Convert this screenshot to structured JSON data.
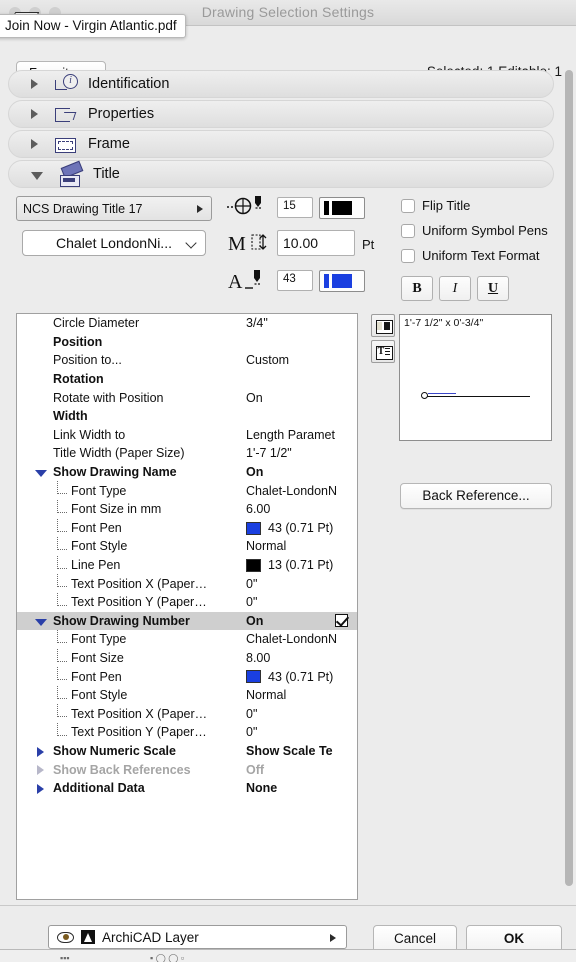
{
  "window": {
    "title": "Drawing Selection Settings",
    "tooltip": "Join Now - Virgin Atlantic.pdf"
  },
  "toolbar": {
    "favorites_label": "Favorites...",
    "selection_info": "Selected: 1 Editable: 1"
  },
  "sections": [
    {
      "label": "Identification",
      "icon": "identification-icon",
      "expanded": false
    },
    {
      "label": "Properties",
      "icon": "properties-icon",
      "expanded": false
    },
    {
      "label": "Frame",
      "icon": "frame-icon",
      "expanded": false
    },
    {
      "label": "Title",
      "icon": "title-icon",
      "expanded": true
    }
  ],
  "controls": {
    "title_style_popup": "NCS Drawing Title 17",
    "font_family": "Chalet LondonNi...",
    "symbol_pen_value": "15",
    "font_size_value": "10.00",
    "font_size_unit": "Pt",
    "text_pen_value": "43",
    "symbol_pen_color": "#000000",
    "text_pen_color": "#1a3fe0",
    "checkboxes": [
      {
        "label": "Flip Title",
        "checked": false
      },
      {
        "label": "Uniform Symbol Pens",
        "checked": false
      },
      {
        "label": "Uniform Text Format",
        "checked": false
      }
    ],
    "style_buttons": [
      {
        "label": "B",
        "name": "bold-button"
      },
      {
        "label": "I",
        "name": "italic-button"
      },
      {
        "label": "U",
        "name": "underline-button"
      }
    ]
  },
  "parameters": [
    {
      "name": "Circle Diameter",
      "value": "3/4\"",
      "level": 0,
      "bold": false,
      "tri": "none"
    },
    {
      "name": "Position",
      "value": "",
      "level": 0,
      "bold": true,
      "tri": "none"
    },
    {
      "name": "Position to...",
      "value": "Custom",
      "level": 0,
      "bold": false,
      "tri": "none"
    },
    {
      "name": "Rotation",
      "value": "",
      "level": 0,
      "bold": true,
      "tri": "none"
    },
    {
      "name": "Rotate with Position",
      "value": "On",
      "level": 0,
      "bold": false,
      "tri": "none"
    },
    {
      "name": "Width",
      "value": "",
      "level": 0,
      "bold": true,
      "tri": "none"
    },
    {
      "name": "Link Width to",
      "value": "Length Paramet",
      "level": 0,
      "bold": false,
      "tri": "none"
    },
    {
      "name": "Title Width (Paper Size)",
      "value": "1'-7 1/2\"",
      "level": 0,
      "bold": false,
      "tri": "none"
    },
    {
      "name": "Show Drawing Name",
      "value": "On",
      "level": 0,
      "bold": true,
      "tri": "open"
    },
    {
      "name": "Font Type",
      "value": "Chalet-LondonN",
      "level": 1,
      "bold": false,
      "tri": "none"
    },
    {
      "name": "Font Size in mm",
      "value": "6.00",
      "level": 1,
      "bold": false,
      "tri": "none"
    },
    {
      "name": "Font Pen",
      "value": "43 (0.71 Pt)",
      "level": 1,
      "bold": false,
      "tri": "none",
      "swatch": "#1a3fe0"
    },
    {
      "name": "Font Style",
      "value": "Normal",
      "level": 1,
      "bold": false,
      "tri": "none"
    },
    {
      "name": "Line Pen",
      "value": "13 (0.71 Pt)",
      "level": 1,
      "bold": false,
      "tri": "none",
      "swatch": "#000000"
    },
    {
      "name": "Text Position X (Paper…",
      "value": "0\"",
      "level": 1,
      "bold": false,
      "tri": "none"
    },
    {
      "name": "Text Position Y (Paper…",
      "value": "0\"",
      "level": 1,
      "bold": false,
      "tri": "none"
    },
    {
      "name": "Show Drawing Number",
      "value": "On",
      "level": 0,
      "bold": true,
      "tri": "open",
      "selected": true,
      "checked": true
    },
    {
      "name": "Font Type",
      "value": "Chalet-LondonN",
      "level": 1,
      "bold": false,
      "tri": "none"
    },
    {
      "name": "Font Size",
      "value": "8.00",
      "level": 1,
      "bold": false,
      "tri": "none"
    },
    {
      "name": "Font Pen",
      "value": "43 (0.71 Pt)",
      "level": 1,
      "bold": false,
      "tri": "none",
      "swatch": "#1a3fe0"
    },
    {
      "name": "Font Style",
      "value": "Normal",
      "level": 1,
      "bold": false,
      "tri": "none"
    },
    {
      "name": "Text Position X (Paper…",
      "value": "0\"",
      "level": 1,
      "bold": false,
      "tri": "none"
    },
    {
      "name": "Text Position Y (Paper…",
      "value": "0\"",
      "level": 1,
      "bold": false,
      "tri": "none"
    },
    {
      "name": "Show Numeric Scale",
      "value": "Show Scale Te",
      "level": 0,
      "bold": true,
      "tri": "closed"
    },
    {
      "name": "Show Back References",
      "value": "Off",
      "level": 0,
      "bold": true,
      "tri": "closed",
      "dim": true
    },
    {
      "name": "Additional Data",
      "value": "None",
      "level": 0,
      "bold": true,
      "tri": "closed"
    }
  ],
  "preview": {
    "dimensions_label": "1'-7 1/2\" x 0'-3/4\"",
    "view_toggle_1": "preview-symbol-view-icon",
    "view_toggle_2": "preview-text-view-icon",
    "back_reference_label": "Back Reference..."
  },
  "footer": {
    "layer_icon": "layer-stack-icon",
    "visibility_icon": "eye-icon",
    "layer_name": "ArchiCAD Layer",
    "cancel_label": "Cancel",
    "ok_label": "OK"
  }
}
